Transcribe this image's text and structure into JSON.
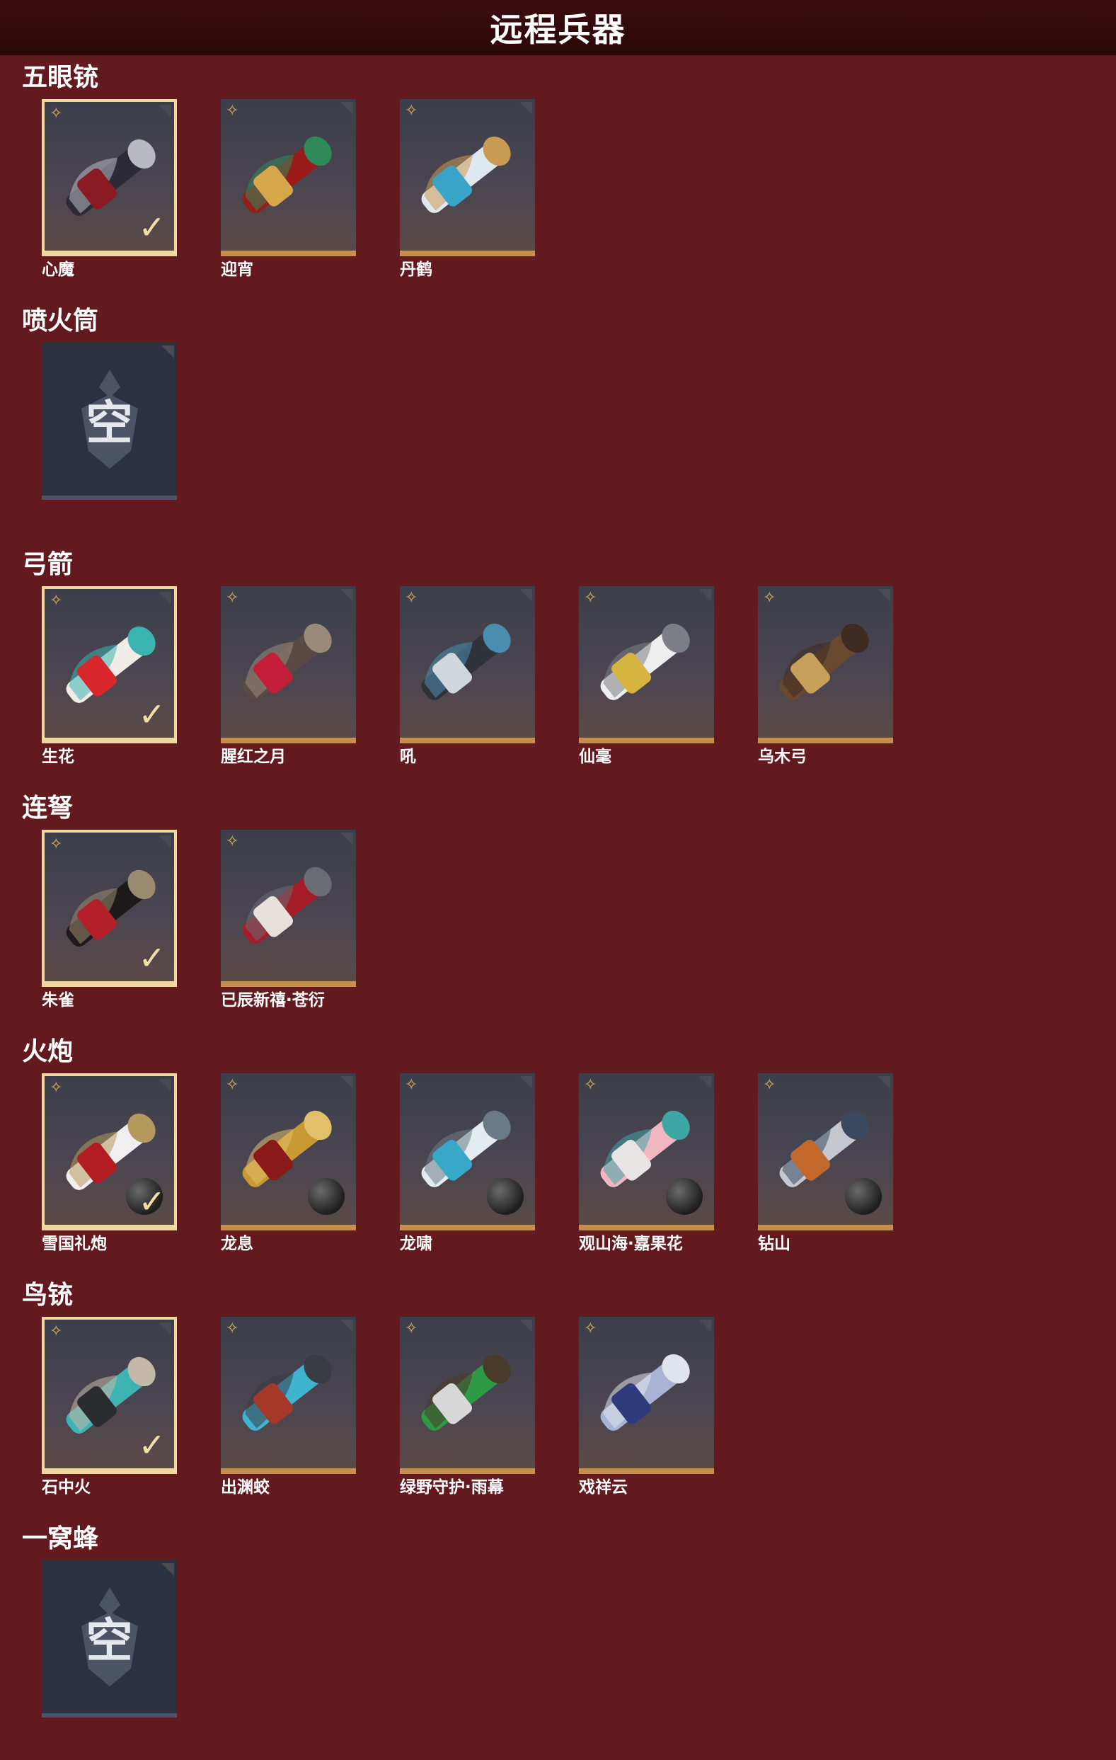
{
  "header": {
    "title": "远程兵器"
  },
  "icons": {
    "star": "sparkle-star-icon",
    "check": "checkmark-icon",
    "orb": "cannonball-icon"
  },
  "colors": {
    "background": "#621a1e",
    "header": "#2e080a",
    "frame": "#c98f4f",
    "selected": "#f0d79e",
    "star": "#e3b25a"
  },
  "sections": [
    {
      "title": "五眼铳",
      "items": [
        {
          "name": "心魔",
          "selected": true,
          "palette": [
            "#2c2a35",
            "#8a1a24",
            "#b9b9c2"
          ]
        },
        {
          "name": "迎宵",
          "selected": false,
          "palette": [
            "#9b1b1b",
            "#d6a64a",
            "#2f8a5a"
          ]
        },
        {
          "name": "丹鹤",
          "selected": false,
          "palette": [
            "#dfe8ee",
            "#3aa3c8",
            "#c89a53"
          ]
        }
      ]
    },
    {
      "title": "喷火筒",
      "items": [
        {
          "name": "",
          "empty": true,
          "empty_label": "空"
        }
      ]
    },
    {
      "title": "弓箭",
      "items": [
        {
          "name": "生花",
          "selected": true,
          "palette": [
            "#f1ece8",
            "#d8262c",
            "#3bb4b0"
          ]
        },
        {
          "name": "腥红之月",
          "selected": false,
          "palette": [
            "#5a4a45",
            "#c21e3a",
            "#9a8a7a"
          ]
        },
        {
          "name": "吼",
          "selected": false,
          "palette": [
            "#2f3238",
            "#cfd6dc",
            "#4b8db0"
          ]
        },
        {
          "name": "仙毫",
          "selected": false,
          "palette": [
            "#eeeeee",
            "#d7b440",
            "#7d7f86"
          ]
        },
        {
          "name": "乌木弓",
          "selected": false,
          "palette": [
            "#6a4a2e",
            "#c7a05a",
            "#3e2c22"
          ]
        }
      ]
    },
    {
      "title": "连弩",
      "items": [
        {
          "name": "朱雀",
          "selected": true,
          "palette": [
            "#1e1a1c",
            "#b3202a",
            "#9a8a70"
          ]
        },
        {
          "name": "已辰新禧·苍衍",
          "selected": false,
          "palette": [
            "#a31c28",
            "#e7e1dc",
            "#6c6c74"
          ]
        }
      ]
    },
    {
      "title": "火炮",
      "items": [
        {
          "name": "雪国礼炮",
          "selected": true,
          "palette": [
            "#f1eef0",
            "#b41c24",
            "#b49a5c"
          ],
          "orb": true
        },
        {
          "name": "龙息",
          "selected": false,
          "palette": [
            "#c79a34",
            "#8a1a1a",
            "#e2c06a"
          ],
          "orb": true
        },
        {
          "name": "龙啸",
          "selected": false,
          "palette": [
            "#e4ecef",
            "#38a8c8",
            "#6b7b86"
          ],
          "orb": true
        },
        {
          "name": "观山海·嘉果花",
          "selected": false,
          "palette": [
            "#f0b6c2",
            "#e9e4e4",
            "#3fa6a6"
          ],
          "orb": true
        },
        {
          "name": "钻山",
          "selected": false,
          "palette": [
            "#c5c8ce",
            "#c2682a",
            "#3a4860"
          ],
          "orb": true
        }
      ]
    },
    {
      "title": "鸟铳",
      "items": [
        {
          "name": "石中火",
          "selected": true,
          "palette": [
            "#3fb3b4",
            "#2a2c30",
            "#c4b8a8"
          ]
        },
        {
          "name": "出渊蛟",
          "selected": false,
          "palette": [
            "#3fb3d0",
            "#a6382a",
            "#3a3c44"
          ]
        },
        {
          "name": "绿野守护·雨幕",
          "selected": false,
          "palette": [
            "#2f9a46",
            "#d7d7d7",
            "#4a3a2a"
          ]
        },
        {
          "name": "戏祥云",
          "selected": false,
          "palette": [
            "#a9b4d4",
            "#2f3a7a",
            "#e0e4ec"
          ]
        }
      ]
    },
    {
      "title": "一窝蜂",
      "items": [
        {
          "name": "",
          "empty": true,
          "empty_label": "空"
        }
      ]
    }
  ]
}
